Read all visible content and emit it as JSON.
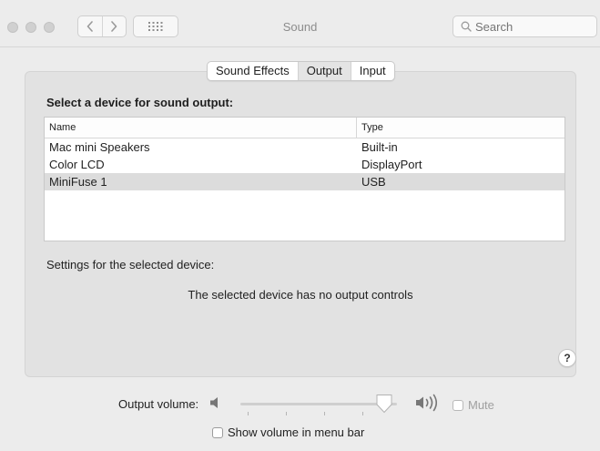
{
  "window": {
    "title": "Sound",
    "search_placeholder": "Search"
  },
  "toolbar": {
    "back_icon": "chevron-left-icon",
    "forward_icon": "chevron-right-icon",
    "show_all_icon": "grid-icon"
  },
  "tabs": [
    {
      "label": "Sound Effects",
      "selected": false
    },
    {
      "label": "Output",
      "selected": true
    },
    {
      "label": "Input",
      "selected": false
    }
  ],
  "output": {
    "heading": "Select a device for sound output:",
    "columns": {
      "name": "Name",
      "type": "Type"
    },
    "devices": [
      {
        "name": "Mac mini Speakers",
        "type": "Built-in",
        "selected": false
      },
      {
        "name": "Color LCD",
        "type": "DisplayPort",
        "selected": false
      },
      {
        "name": "MiniFuse 1",
        "type": "USB",
        "selected": true
      }
    ],
    "settings_label": "Settings for the selected device:",
    "no_controls_message": "The selected device has no output controls",
    "help_label": "?"
  },
  "volume": {
    "label": "Output volume:",
    "level": 0.92,
    "mute_label": "Mute",
    "mute_checked": false,
    "show_in_menu_bar_label": "Show volume in menu bar",
    "show_in_menu_bar_checked": false
  }
}
